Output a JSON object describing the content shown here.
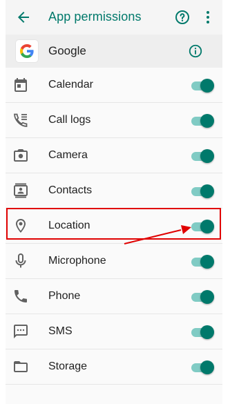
{
  "appbar": {
    "title": "App permissions",
    "back_icon": "arrow-back-icon",
    "help_icon": "help-circle-icon",
    "more_icon": "more-vert-icon",
    "accent_color": "#00796b"
  },
  "app": {
    "name": "Google",
    "logo_icon": "google-logo-icon",
    "info_icon": "info-icon"
  },
  "permissions": [
    {
      "label": "Calendar",
      "icon": "calendar-icon",
      "enabled": true
    },
    {
      "label": "Call logs",
      "icon": "call-log-icon",
      "enabled": true
    },
    {
      "label": "Camera",
      "icon": "camera-icon",
      "enabled": true
    },
    {
      "label": "Contacts",
      "icon": "contacts-icon",
      "enabled": true
    },
    {
      "label": "Location",
      "icon": "location-pin-icon",
      "enabled": true
    },
    {
      "label": "Microphone",
      "icon": "microphone-icon",
      "enabled": true
    },
    {
      "label": "Phone",
      "icon": "phone-icon",
      "enabled": true
    },
    {
      "label": "SMS",
      "icon": "sms-icon",
      "enabled": true
    },
    {
      "label": "Storage",
      "icon": "folder-icon",
      "enabled": true
    }
  ],
  "annotation": {
    "highlighted_item": "Location",
    "color": "#e00000"
  }
}
